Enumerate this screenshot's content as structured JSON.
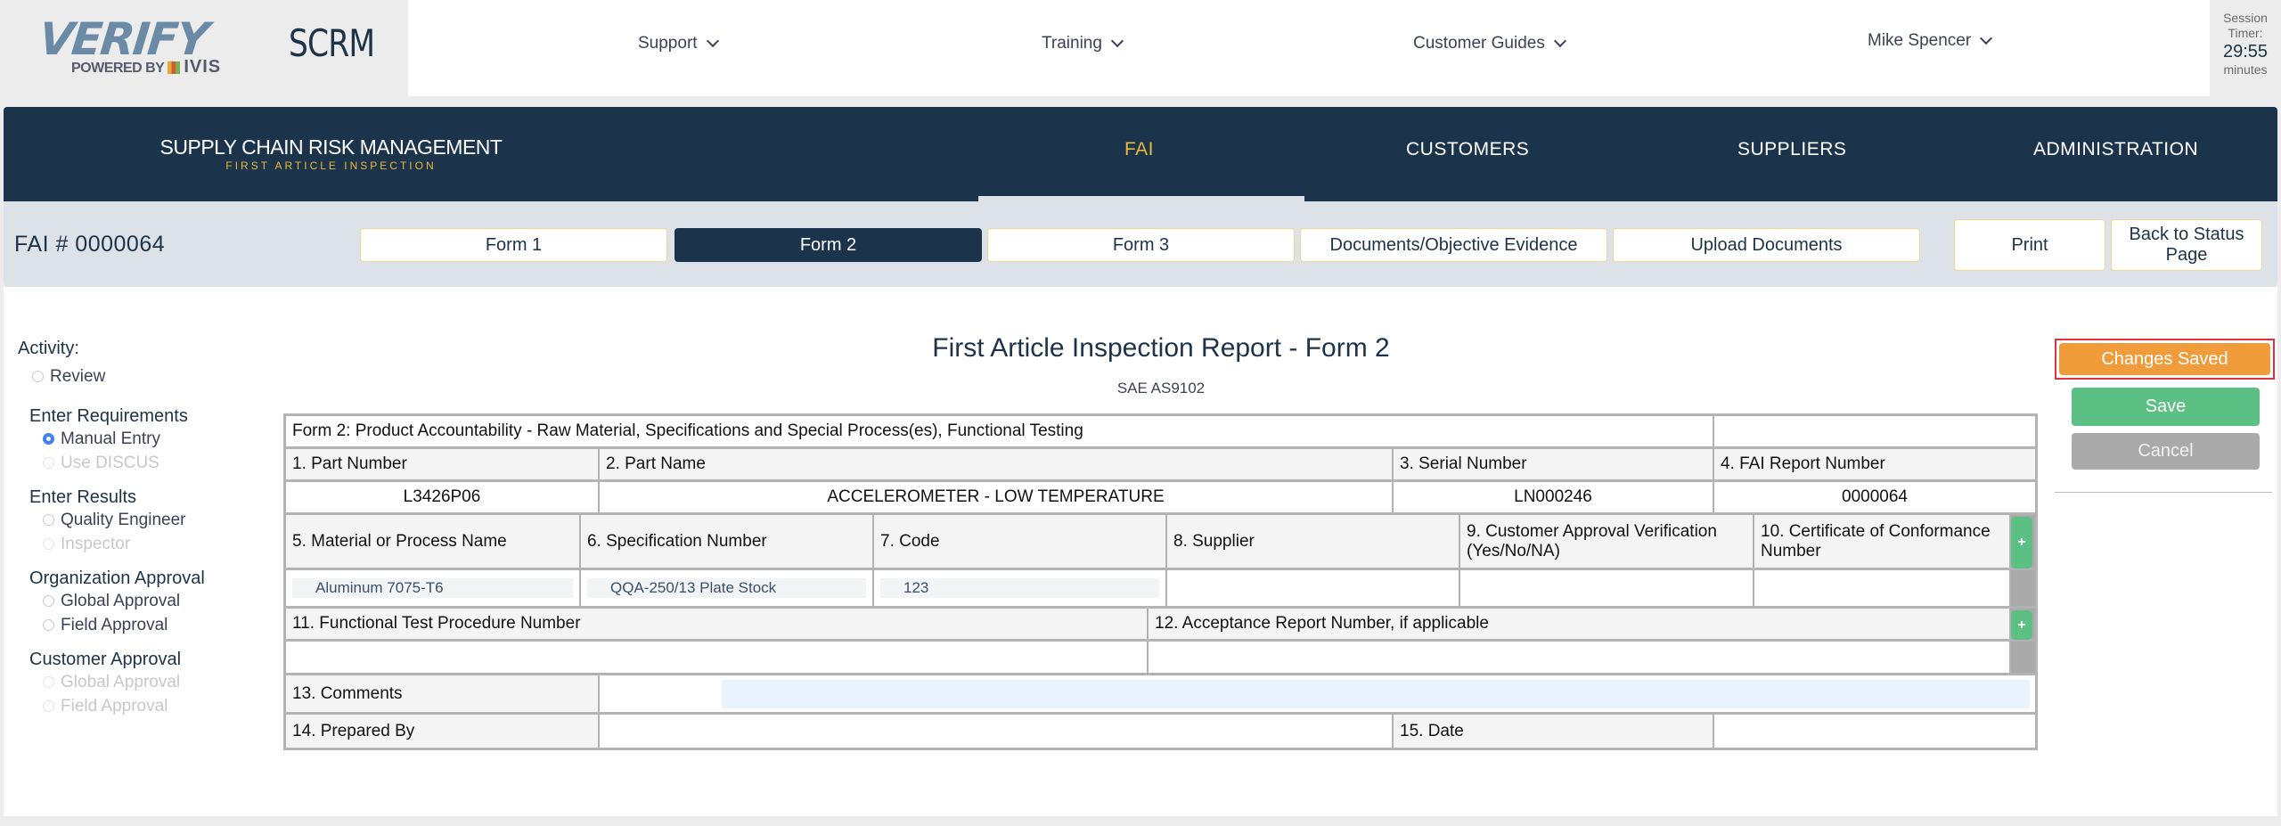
{
  "header": {
    "logo_text": "VERIFY",
    "logo_powered_by": "POWERED BY",
    "logo_vendor": "IVIS",
    "app_name": "SCRM",
    "nav": [
      {
        "label": "Support",
        "icon": "chevron-down-icon"
      },
      {
        "label": "Training",
        "icon": "chevron-down-icon"
      },
      {
        "label": "Customer Guides",
        "icon": "chevron-down-icon"
      }
    ],
    "user": {
      "name": "Mike Spencer",
      "icon": "chevron-down-icon"
    },
    "session_timer": {
      "label_line1": "Session",
      "label_line2": "Timer:",
      "value": "29:55",
      "unit": "minutes"
    }
  },
  "main_nav": {
    "title": "SUPPLY CHAIN RISK MANAGEMENT",
    "subtitle": "FIRST ARTICLE INSPECTION",
    "tabs": [
      {
        "label": "FAI",
        "active": true
      },
      {
        "label": "CUSTOMERS",
        "active": false
      },
      {
        "label": "SUPPLIERS",
        "active": false
      },
      {
        "label": "ADMINISTRATION",
        "active": false
      }
    ],
    "accent_color": "#e8b93b"
  },
  "form_strip": {
    "fai_number": "FAI # 0000064",
    "tabs": [
      {
        "label": "Form 1",
        "active": false
      },
      {
        "label": "Form 2",
        "active": true
      },
      {
        "label": "Form 3",
        "active": false
      },
      {
        "label": "Documents/Objective Evidence",
        "active": false
      },
      {
        "label": "Upload Documents",
        "active": false
      }
    ],
    "print_label": "Print",
    "back_label": "Back to Status Page"
  },
  "sidebar": {
    "activity_label": "Activity:",
    "review": {
      "label": "Review",
      "checked": false
    },
    "groups": [
      {
        "heading": "Enter Requirements",
        "options": [
          {
            "label": "Manual Entry",
            "checked": true,
            "disabled": false
          },
          {
            "label": "Use DISCUS",
            "checked": false,
            "disabled": true
          }
        ]
      },
      {
        "heading": "Enter Results",
        "options": [
          {
            "label": "Quality Engineer",
            "checked": false,
            "disabled": false
          },
          {
            "label": "Inspector",
            "checked": false,
            "disabled": true
          }
        ]
      },
      {
        "heading": "Organization Approval",
        "options": [
          {
            "label": "Global Approval",
            "checked": false,
            "disabled": false
          },
          {
            "label": "Field Approval",
            "checked": false,
            "disabled": false
          }
        ]
      },
      {
        "heading": "Customer Approval",
        "options": [
          {
            "label": "Global Approval",
            "checked": false,
            "disabled": true
          },
          {
            "label": "Field Approval",
            "checked": false,
            "disabled": true
          }
        ]
      }
    ]
  },
  "report": {
    "title": "First Article Inspection Report - Form 2",
    "standard": "SAE AS9102",
    "form_heading": "Form 2: Product Accountability - Raw Material, Specifications and Special Process(es), Functional Testing",
    "fields": {
      "part_number": {
        "label": "1. Part Number",
        "value": "L3426P06"
      },
      "part_name": {
        "label": "2. Part Name",
        "value": "ACCELEROMETER - LOW TEMPERATURE"
      },
      "serial_number": {
        "label": "3. Serial Number",
        "value": "LN000246"
      },
      "fai_report_number": {
        "label": "4. FAI Report Number",
        "value": "0000064"
      }
    },
    "materials_columns": [
      "5. Material or Process Name",
      "6. Specification Number",
      "7. Code",
      "8. Supplier",
      "9. Customer Approval Verification (Yes/No/NA)",
      "10. Certificate of Conformance Number"
    ],
    "materials_rows": [
      {
        "material": "Aluminum 7075-T6",
        "specification": "QQA-250/13 Plate Stock",
        "code": "123",
        "supplier": "",
        "customer_approval": "",
        "coc_number": ""
      }
    ],
    "functional_columns": [
      "11. Functional Test Procedure Number",
      "12. Acceptance Report Number, if applicable"
    ],
    "functional_rows": [
      {
        "procedure_number": "",
        "acceptance_report": ""
      }
    ],
    "comments": {
      "label": "13. Comments",
      "value": ""
    },
    "prepared_by": {
      "label": "14. Prepared By",
      "value": ""
    },
    "date": {
      "label": "15. Date",
      "value": ""
    },
    "add_row_label": "+"
  },
  "actions": {
    "changes_saved_label": "Changes Saved",
    "save_label": "Save",
    "cancel_label": "Cancel",
    "colors": {
      "changes_saved": "#f09c3b",
      "save": "#5cbf83",
      "cancel": "#aaaaaa",
      "highlight": "#e1303f"
    }
  }
}
